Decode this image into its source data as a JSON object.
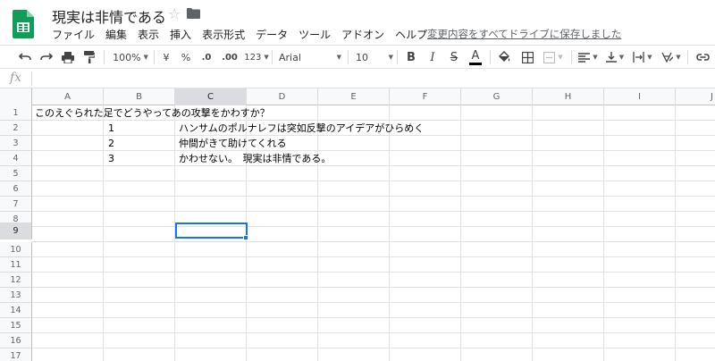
{
  "doc": {
    "title": "現実は非情である"
  },
  "menu": [
    "ファイル",
    "編集",
    "表示",
    "挿入",
    "表示形式",
    "データ",
    "ツール",
    "アドオン",
    "ヘルプ"
  ],
  "save_status": "変更内容をすべてドライブに保存しました",
  "toolbar": {
    "zoom": "100%",
    "currency": "¥",
    "percent": "%",
    "decimal_decrease": ".0",
    "decimal_increase": ".00",
    "more_formats": "123",
    "font": "Arial",
    "font_size": "10",
    "bold": "B",
    "italic": "I",
    "strike": "S",
    "text_color": "A"
  },
  "formula_bar": {
    "fx_label": "fx",
    "value": ""
  },
  "columns": [
    "A",
    "B",
    "C",
    "D",
    "E",
    "F",
    "G",
    "H",
    "I",
    "J"
  ],
  "rows": [
    "1",
    "2",
    "3",
    "4",
    "5",
    "6",
    "7",
    "8",
    "9",
    "10",
    "11",
    "12",
    "13",
    "14",
    "15",
    "16",
    "17"
  ],
  "cells": {
    "A1": "このえぐられた足でどうやってあの攻撃をかわすか？",
    "B2": "1",
    "C2": "ハンサムのポルナレフは突如反撃のアイデアがひらめく",
    "B3": "2",
    "C3": "仲間がきて助けてくれる",
    "B4": "3",
    "C4": "かわせない。　現実は非情である。"
  },
  "selected_cell": "C9",
  "colors": {
    "accent": "#1a73e8",
    "logo": "#0f9d58"
  }
}
